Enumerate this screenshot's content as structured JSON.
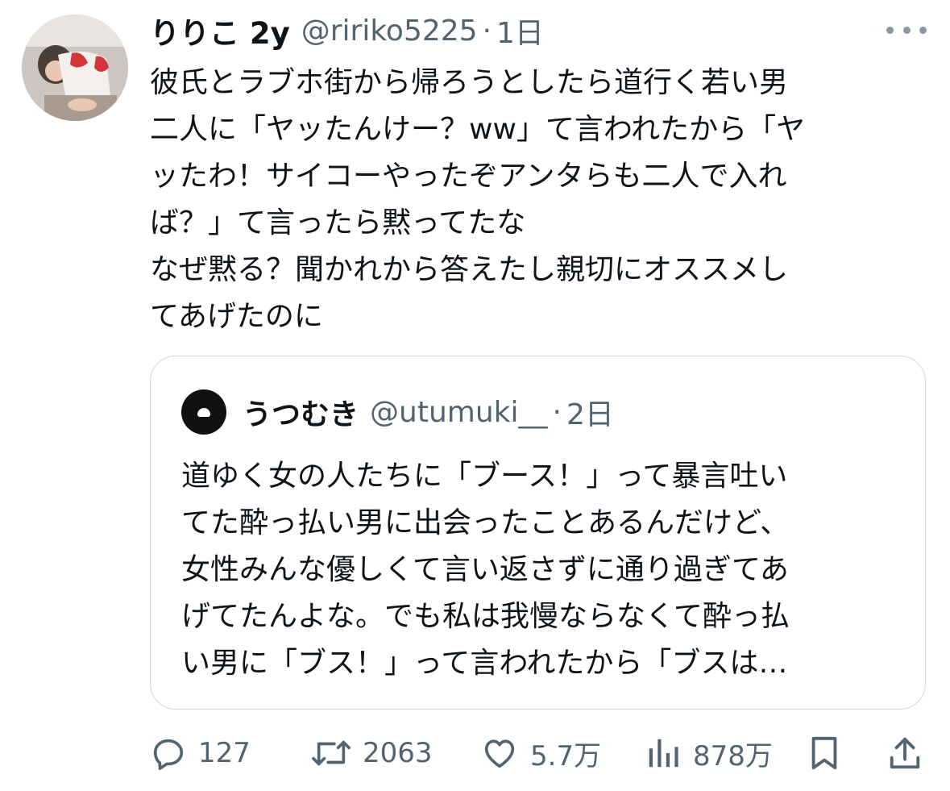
{
  "tweet": {
    "display_name": "りりこ 2y",
    "handle": "@ririko5225",
    "separator": "·",
    "time": "1日",
    "text_lines": [
      "彼氏とラブホ街から帰ろうとしたら道行く若い男",
      "二人に「ヤッたんけー？ww」て言われたから「ヤ",
      "ッたわ！サイコーやったぞアンタらも二人で入れ",
      "ば？」て言ったら黙ってたな",
      "なぜ黙る？聞かれから答えたし親切にオススメし",
      "てあげたのに"
    ]
  },
  "quoted_tweet": {
    "display_name": "うつむき",
    "handle": "@utumuki__",
    "separator": "·",
    "time": "2日",
    "text_lines": [
      "道ゆく女の人たちに「ブース！」って暴言吐い",
      "てた酔っ払い男に出会ったことあるんだけど、",
      "女性みんな優しくて言い返さずに通り過ぎてあ",
      "げてたんよな。でも私は我慢ならなくて酔っ払",
      "い男に「ブス！」って言われたから「ブスは…"
    ]
  },
  "actions": {
    "replies": "127",
    "reposts": "2063",
    "likes": "5.7万",
    "views": "878万"
  },
  "icons": {
    "reply": "speech-bubble-icon",
    "repost": "repost-arrows-icon",
    "like": "heart-icon",
    "views": "bar-chart-icon",
    "bookmark": "bookmark-icon",
    "share": "share-upload-icon",
    "more": "more-dots-icon"
  },
  "colors": {
    "text": "#0f1419",
    "secondary": "#536471",
    "border": "#cfd9de"
  }
}
